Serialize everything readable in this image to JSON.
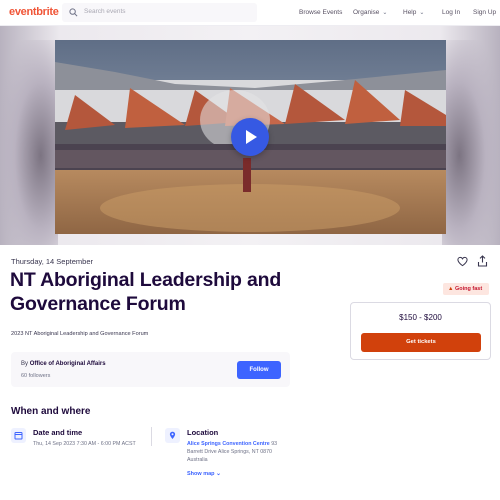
{
  "header": {
    "logo": "eventbrite",
    "search_placeholder": "Search events",
    "nav": {
      "browse": "Browse Events",
      "organise": "Organise",
      "help": "Help",
      "login": "Log In",
      "signup": "Sign Up"
    }
  },
  "event": {
    "date": "Thursday, 14 September",
    "title": "NT Aboriginal Leadership and Governance Forum",
    "summary": "2023 NT Aboriginal Leadership and Governance Forum",
    "organizer": {
      "by_label": "By",
      "name": "Office of Aboriginal Affairs",
      "followers": "60 followers",
      "follow_label": "Follow"
    },
    "when_where": {
      "heading": "When and where",
      "date_time_title": "Date and time",
      "date_time_value": "Thu, 14 Sep 2023 7:30 AM - 6:00 PM ACST",
      "location_title": "Location",
      "venue": "Alice Springs Convention Centre",
      "address_line1_suffix": "93",
      "address_line2": "Barrett Drive Alice Springs, NT 0870",
      "address_line3": "Australia",
      "show_map": "Show map"
    }
  },
  "ticket": {
    "badge": "Going fast",
    "price": "$150 - $200",
    "button": "Get tickets"
  },
  "colors": {
    "brand": "#f05537",
    "primary_blue": "#3d64ff",
    "cta_orange": "#d1410c",
    "title": "#1e0a3c"
  },
  "icons": {
    "search": "search-icon",
    "play": "play-icon",
    "like": "heart-icon",
    "share": "share-icon",
    "calendar": "calendar-icon",
    "location": "location-pin-icon",
    "fire": "fire-icon"
  }
}
